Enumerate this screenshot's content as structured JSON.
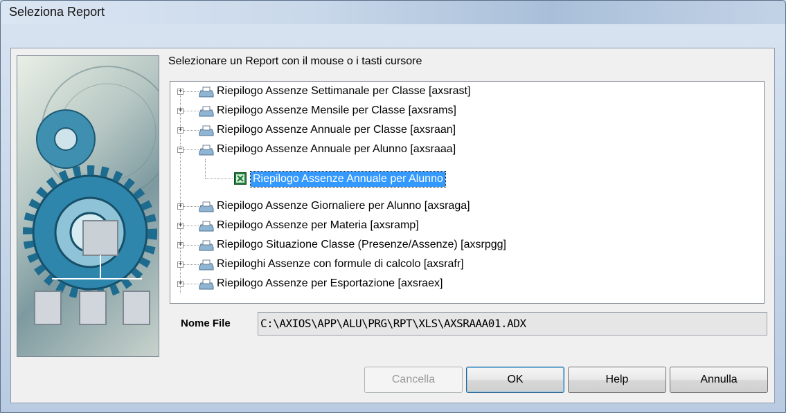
{
  "window": {
    "title": "Seleziona Report"
  },
  "prompt": "Selezionare un Report con il mouse o i tasti cursore",
  "tree": {
    "items": [
      {
        "label": "Riepilogo Assenze Settimanale per Classe [axsrast]",
        "expander": "+"
      },
      {
        "label": "Riepilogo Assenze Mensile per Classe [axsrams]",
        "expander": "+"
      },
      {
        "label": "Riepilogo Assenze Annuale per Classe [axsraan]",
        "expander": "+"
      },
      {
        "label": "Riepilogo Assenze Annuale per Alunno [axsraaa]",
        "expander": "−"
      },
      {
        "label": "Riepilogo Assenze Giornaliere per Alunno [axsraga]",
        "expander": "+"
      },
      {
        "label": "Riepilogo Assenze per Materia [axsramp]",
        "expander": "+"
      },
      {
        "label": "Riepilogo Situazione Classe (Presenze/Assenze) [axsrpgg]",
        "expander": "+"
      },
      {
        "label": "Riepiloghi Assenze con formule di calcolo [axsrafr]",
        "expander": "+"
      },
      {
        "label": "Riepilogo Assenze per Esportazione [axsraex]",
        "expander": "+"
      }
    ],
    "selected_child": "Riepilogo Assenze Annuale per Alunno"
  },
  "file": {
    "label": "Nome File",
    "value": "C:\\AXIOS\\APP\\ALU\\PRG\\RPT\\XLS\\AXSRAAA01.ADX"
  },
  "buttons": {
    "cancella": "Cancella",
    "ok": "OK",
    "help": "Help",
    "annulla": "Annulla"
  },
  "icons": {
    "tree_item": "printer-icon",
    "child_item": "excel-icon"
  }
}
